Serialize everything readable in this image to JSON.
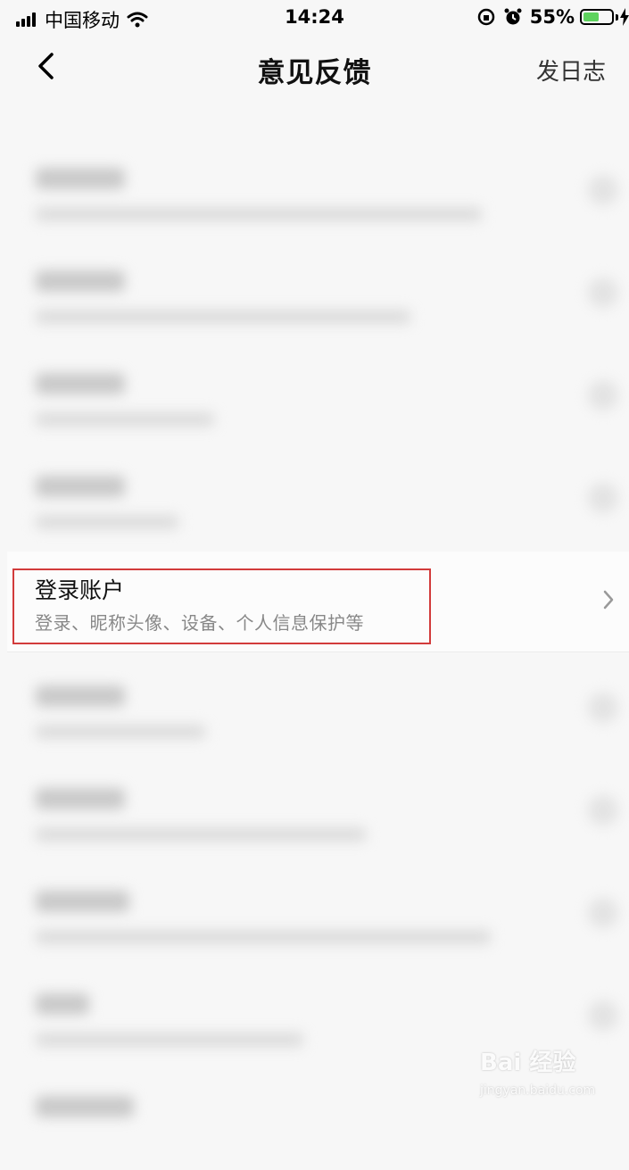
{
  "status_bar": {
    "carrier": "中国移动",
    "time": "14:24",
    "battery_percent": "55%",
    "battery_level": 0.55,
    "icons": [
      "signal-icon",
      "wifi-icon",
      "rotation-lock-icon",
      "alarm-icon",
      "battery-icon",
      "charging-icon"
    ]
  },
  "nav": {
    "title": "意见反馈",
    "action": "发日志",
    "back_icon": "back-chevron-icon"
  },
  "list": {
    "highlighted_item": {
      "title": "登录账户",
      "subtitle": "登录、昵称头像、设备、个人信息保护等",
      "icon": "chevron-right-icon"
    }
  },
  "watermark": {
    "brand": "Bai 经验",
    "url": "jingyan.baidu.com"
  },
  "colors": {
    "highlight_border": "#d23b3b",
    "battery_fill": "#5dd25d",
    "background": "#f7f7f7"
  }
}
